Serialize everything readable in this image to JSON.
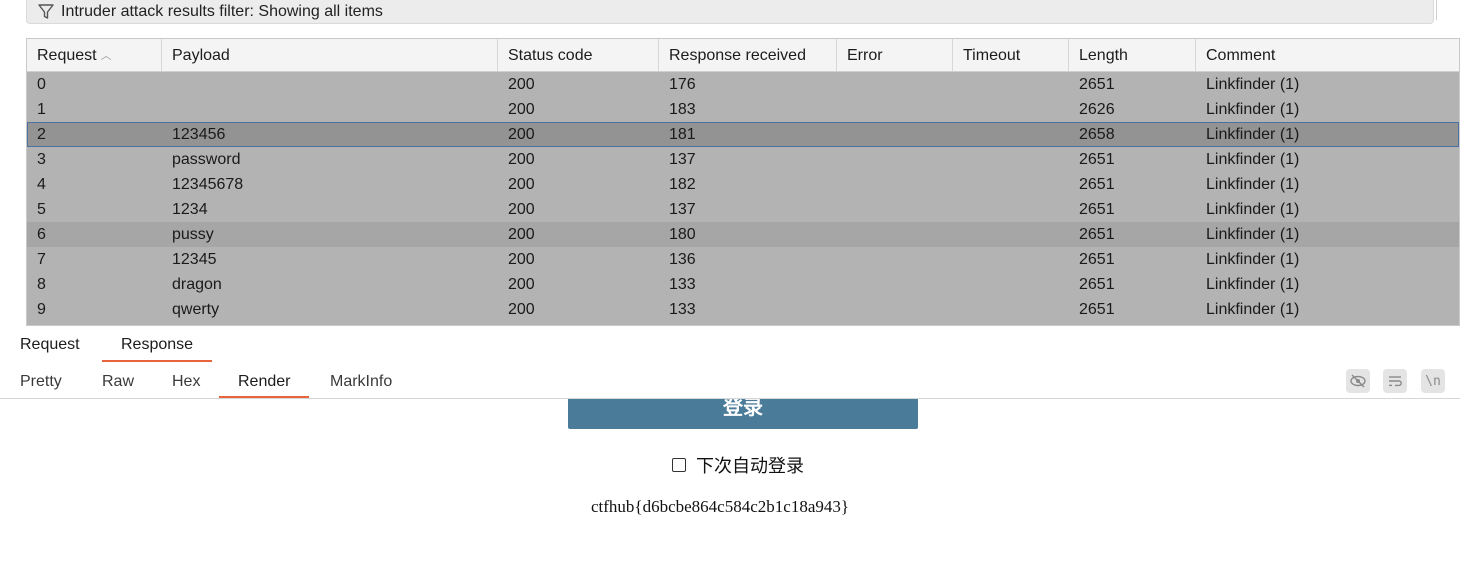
{
  "filter": {
    "text": "Intruder attack results filter: Showing all items"
  },
  "table": {
    "columns": [
      "Request",
      "Payload",
      "Status code",
      "Response received",
      "Error",
      "Timeout",
      "Length",
      "Comment"
    ],
    "sort_column": "Request",
    "rows": [
      {
        "request": "0",
        "payload": "",
        "status": "200",
        "received": "176",
        "error": "",
        "timeout": "",
        "length": "2651",
        "comment": "Linkfinder (1)"
      },
      {
        "request": "1",
        "payload": "",
        "status": "200",
        "received": "183",
        "error": "",
        "timeout": "",
        "length": "2626",
        "comment": "Linkfinder (1)"
      },
      {
        "request": "2",
        "payload": "123456",
        "status": "200",
        "received": "181",
        "error": "",
        "timeout": "",
        "length": "2658",
        "comment": "Linkfinder (1)"
      },
      {
        "request": "3",
        "payload": "password",
        "status": "200",
        "received": "137",
        "error": "",
        "timeout": "",
        "length": "2651",
        "comment": "Linkfinder (1)"
      },
      {
        "request": "4",
        "payload": "12345678",
        "status": "200",
        "received": "182",
        "error": "",
        "timeout": "",
        "length": "2651",
        "comment": "Linkfinder (1)"
      },
      {
        "request": "5",
        "payload": "1234",
        "status": "200",
        "received": "137",
        "error": "",
        "timeout": "",
        "length": "2651",
        "comment": "Linkfinder (1)"
      },
      {
        "request": "6",
        "payload": "pussy",
        "status": "200",
        "received": "180",
        "error": "",
        "timeout": "",
        "length": "2651",
        "comment": "Linkfinder (1)"
      },
      {
        "request": "7",
        "payload": "12345",
        "status": "200",
        "received": "136",
        "error": "",
        "timeout": "",
        "length": "2651",
        "comment": "Linkfinder (1)"
      },
      {
        "request": "8",
        "payload": "dragon",
        "status": "200",
        "received": "133",
        "error": "",
        "timeout": "",
        "length": "2651",
        "comment": "Linkfinder (1)"
      },
      {
        "request": "9",
        "payload": "qwerty",
        "status": "200",
        "received": "133",
        "error": "",
        "timeout": "",
        "length": "2651",
        "comment": "Linkfinder (1)"
      }
    ],
    "selected_row": 2,
    "highlighted_row": 6
  },
  "tabs": {
    "request": "Request",
    "response": "Response",
    "active": "Response"
  },
  "subtabs": {
    "pretty": "Pretty",
    "raw": "Raw",
    "hex": "Hex",
    "render": "Render",
    "markinfo": "MarkInfo",
    "active": "Render"
  },
  "toolbar": {
    "newline_label": "\\n"
  },
  "render": {
    "login_label": "登录",
    "remember_label": "下次自动登录",
    "flag": "ctfhub{d6bcbe864c584c2b1c18a943}"
  },
  "colors": {
    "accent": "#e8643c",
    "login_button": "#4a7b98",
    "selection_outline": "#4b72a0"
  },
  "icons": [
    "filter-icon",
    "sort-ascending-icon",
    "eye-hidden-icon",
    "wrap-lines-icon",
    "newline-icon"
  ]
}
